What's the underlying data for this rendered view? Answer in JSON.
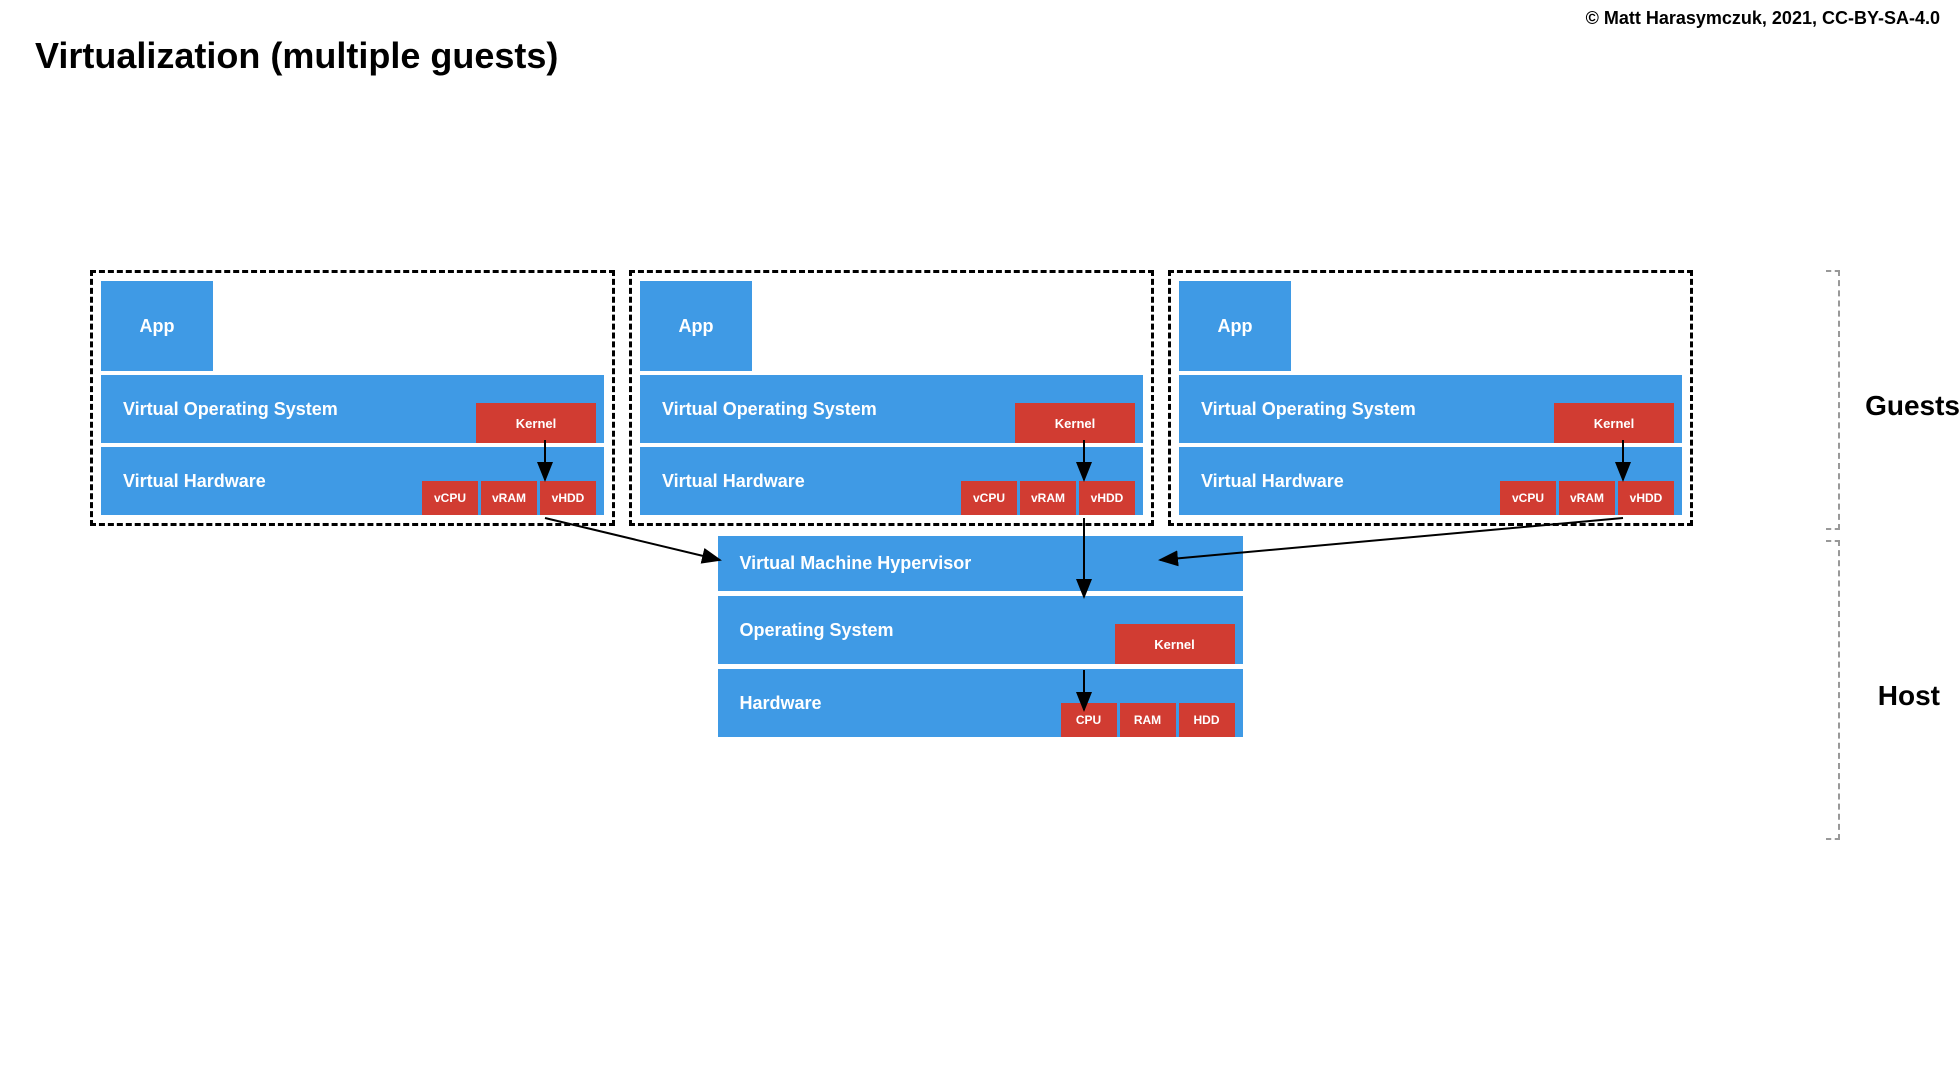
{
  "title": "Virtualization (multiple guests)",
  "copyright": "© Matt Harasymczuk, 2021, CC-BY-SA-4.0",
  "guest": {
    "app": "App",
    "vos": "Virtual Operating System",
    "kernel": "Kernel",
    "vhw": "Virtual Hardware",
    "chips": {
      "vcpu": "vCPU",
      "vram": "vRAM",
      "vhdd": "vHDD"
    }
  },
  "host": {
    "hypervisor": "Virtual Machine Hypervisor",
    "os": "Operating System",
    "kernel": "Kernel",
    "hw": "Hardware",
    "chips": {
      "cpu": "CPU",
      "ram": "RAM",
      "hdd": "HDD"
    }
  },
  "labels": {
    "guests": "Guests",
    "host": "Host"
  }
}
